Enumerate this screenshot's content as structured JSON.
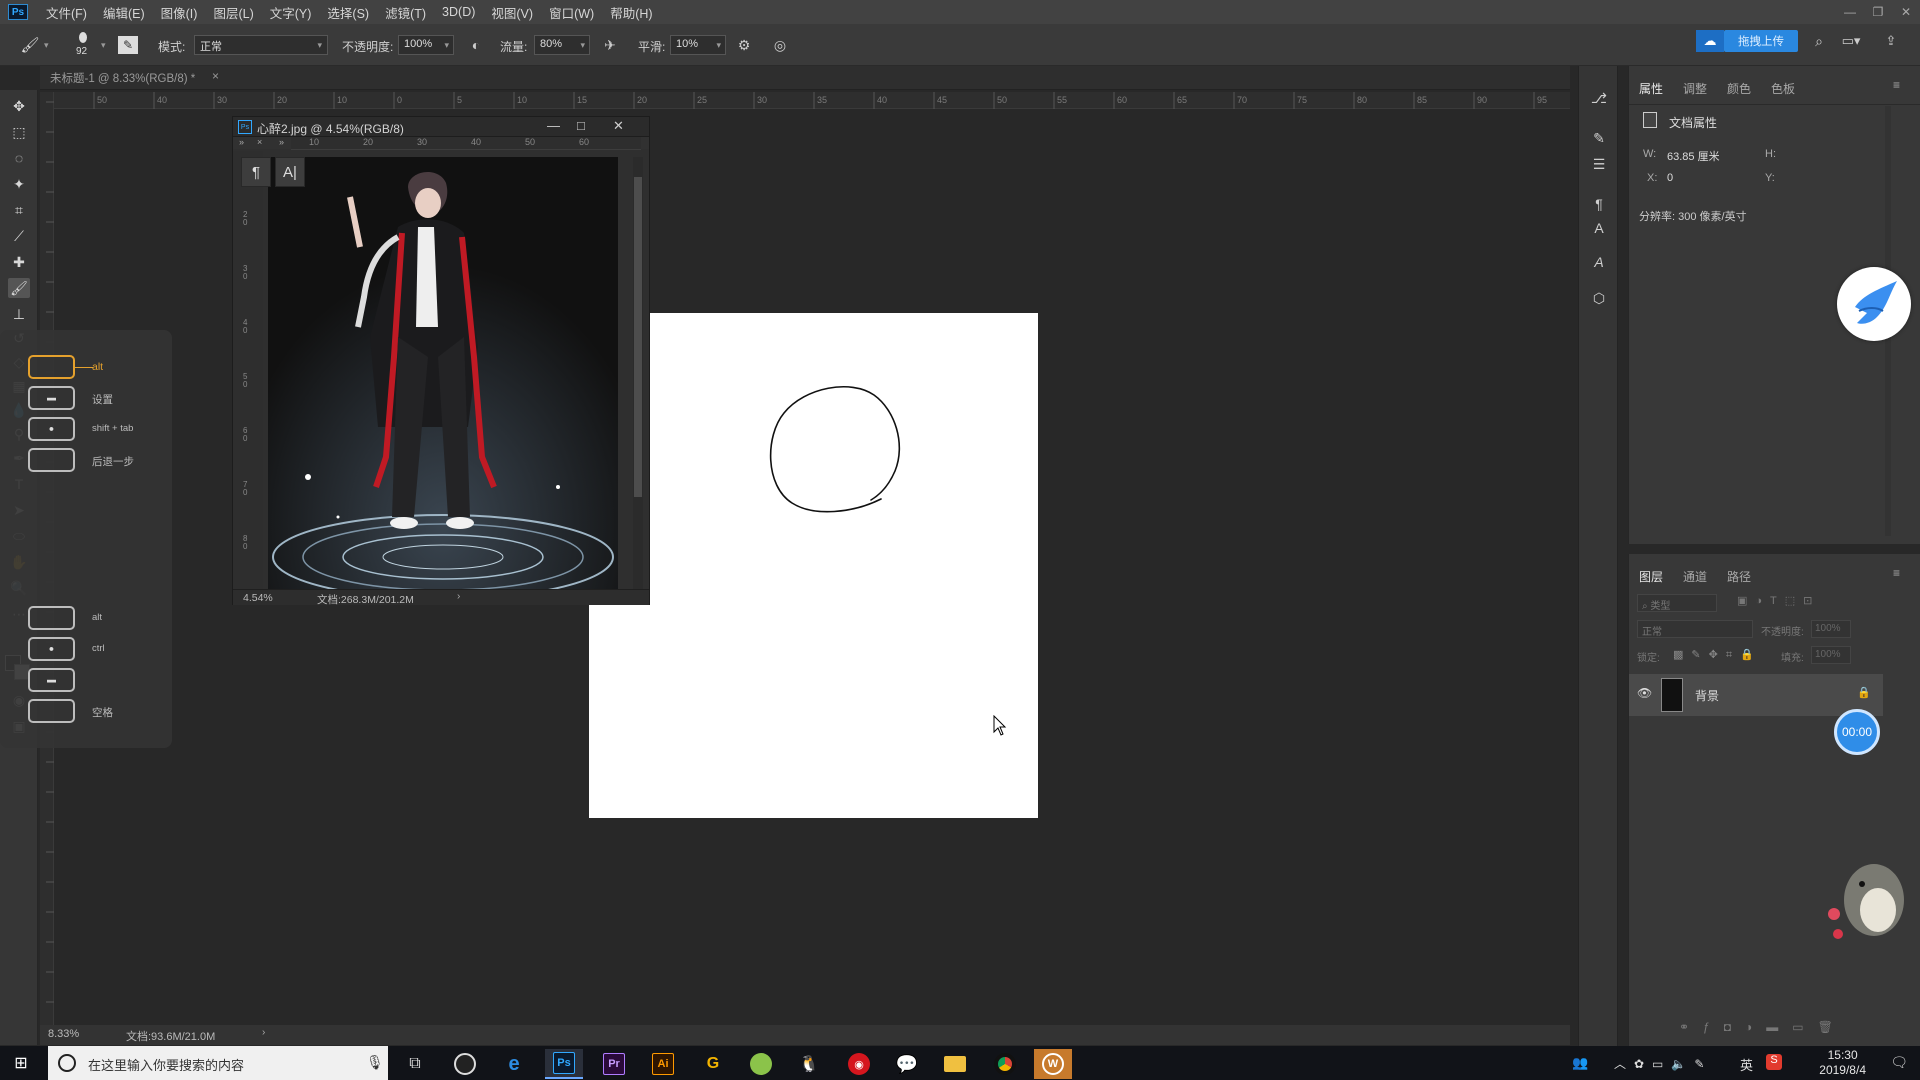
{
  "app": {
    "logo_text": "Ps",
    "menu": [
      "文件(F)",
      "编辑(E)",
      "图像(I)",
      "图层(L)",
      "文字(Y)",
      "选择(S)",
      "滤镜(T)",
      "3D(D)",
      "视图(V)",
      "窗口(W)",
      "帮助(H)"
    ]
  },
  "options": {
    "brush_size": "92",
    "mode_label": "模式:",
    "mode_value": "正常",
    "opacity_label": "不透明度:",
    "opacity_value": "100%",
    "flow_label": "流量:",
    "flow_value": "80%",
    "smooth_label": "平滑:",
    "smooth_value": "10%",
    "upload_button": "拖拽上传"
  },
  "document": {
    "tab_title": "未标题-1 @ 8.33%(RGB/8) *",
    "tab_close": "×",
    "zoom": "8.33%",
    "doc_info": "文档:93.6M/21.0M",
    "ruler_ticks": [
      "50",
      "40",
      "30",
      "20",
      "10",
      "0",
      "5",
      "10",
      "15",
      "20",
      "25",
      "30",
      "35",
      "40",
      "45",
      "50",
      "55",
      "60",
      "65",
      "70",
      "75",
      "80",
      "85",
      "90",
      "95"
    ]
  },
  "float_window": {
    "title": "心醉2.jpg @ 4.54%(RGB/8)",
    "zoom": "4.54%",
    "doc_info": "文档:268.3M/201.2M",
    "ruler_h": [
      "10",
      "20",
      "30",
      "40",
      "50",
      "60"
    ],
    "ruler_v": [
      "2\n0",
      "3\n0",
      "4\n0",
      "5\n0",
      "6\n0",
      "7\n0",
      "8\n0"
    ],
    "paragraph_glyph": "¶",
    "char_glyph": "A|"
  },
  "shortcuts": [
    {
      "label": "alt",
      "glyph": "",
      "active": true
    },
    {
      "label": "设置",
      "glyph": "▬",
      "active": false
    },
    {
      "label": "shift + tab",
      "glyph": "●",
      "active": false
    },
    {
      "label": "后退一步",
      "glyph": "",
      "active": false
    },
    {
      "label": "alt",
      "glyph": "",
      "active": false
    },
    {
      "label": "ctrl",
      "glyph": "●",
      "active": false
    },
    {
      "label": "",
      "glyph": "▬",
      "active": false
    },
    {
      "label": "空格",
      "glyph": "",
      "active": false
    }
  ],
  "properties": {
    "tabs": [
      "属性",
      "调整",
      "颜色",
      "色板"
    ],
    "section": "文档属性",
    "w_label": "W:",
    "w_value": "63.85 厘米",
    "h_label": "H:",
    "x_label": "X:",
    "x_value": "0",
    "y_label": "Y:",
    "resolution": "分辨率: 300 像素/英寸"
  },
  "layers": {
    "tabs": [
      "图层",
      "通道",
      "路径"
    ],
    "filter_placeholder": "类型",
    "blend_mode": "正常",
    "opacity_label": "不透明度:",
    "opacity_value": "100%",
    "lock_label": "锁定:",
    "fill_label": "填充:",
    "fill_value": "100%",
    "layer_name": "背景"
  },
  "overlay": {
    "timer": "00:00"
  },
  "taskbar": {
    "search_text": "在这里输入你要搜索的内容",
    "time": "15:30",
    "date": "2019/8/4",
    "ime": "英",
    "apps": [
      "Pr",
      "Ai",
      "G"
    ]
  },
  "colors": {
    "accent": "#31a8ff",
    "active_shortcut": "#e5a12d",
    "upload": "#2a88e0"
  }
}
